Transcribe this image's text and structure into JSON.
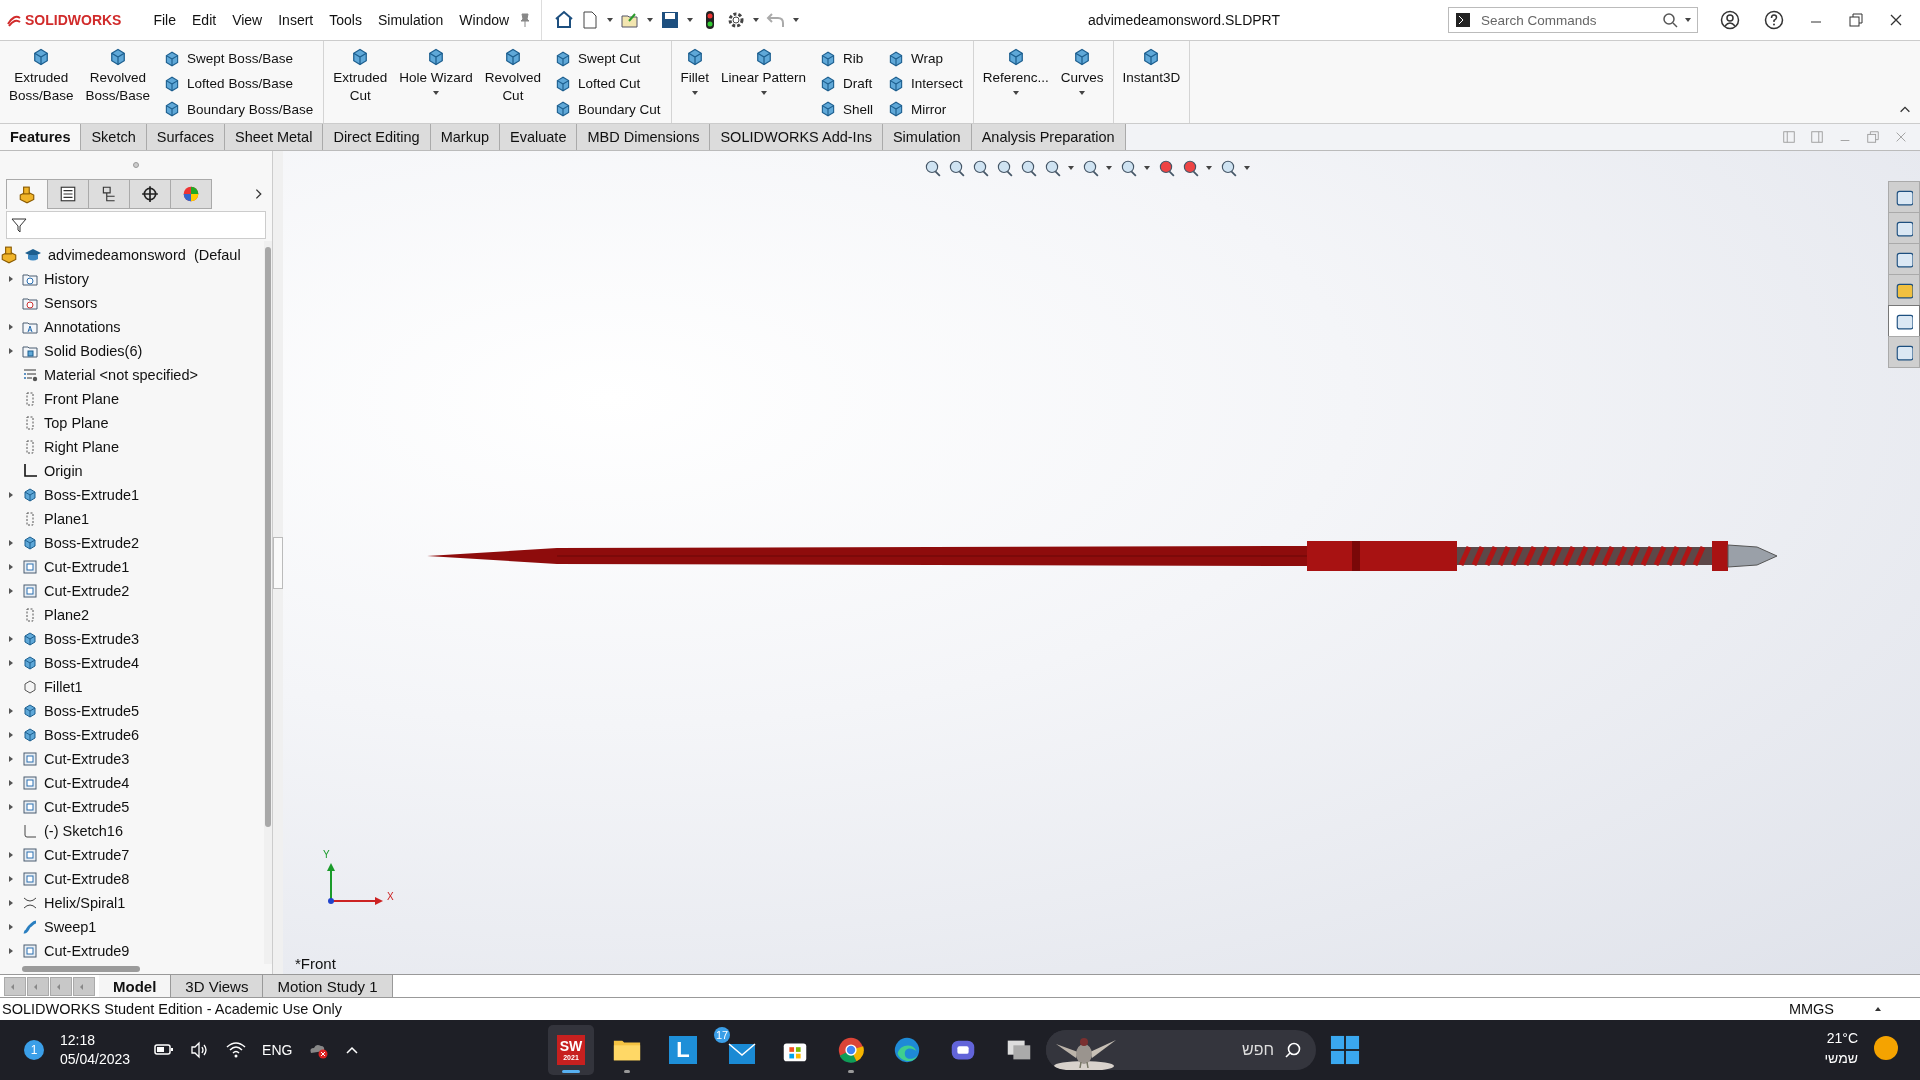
{
  "app": {
    "logo": "SOLIDWORKS"
  },
  "menu": [
    "File",
    "Edit",
    "View",
    "Insert",
    "Tools",
    "Simulation",
    "Window"
  ],
  "document_title": "advimedeamonsword.SLDPRT",
  "search": {
    "placeholder": "Search Commands"
  },
  "ribbon": {
    "groups": [
      {
        "columns": [
          {
            "kind": "large",
            "label": "Extruded\nBoss/Base",
            "dropdown": false
          },
          {
            "kind": "large",
            "label": "Revolved\nBoss/Base",
            "dropdown": false
          },
          {
            "kind": "stack",
            "items": [
              "Swept Boss/Base",
              "Lofted Boss/Base",
              "Boundary Boss/Base"
            ]
          }
        ]
      },
      {
        "columns": [
          {
            "kind": "large",
            "label": "Extruded\nCut",
            "dropdown": false
          },
          {
            "kind": "large",
            "label": "Hole Wizard",
            "dropdown": true
          },
          {
            "kind": "large",
            "label": "Revolved\nCut",
            "dropdown": false
          },
          {
            "kind": "stack",
            "items": [
              "Swept Cut",
              "Lofted Cut",
              "Boundary Cut"
            ]
          }
        ]
      },
      {
        "columns": [
          {
            "kind": "large",
            "label": "Fillet",
            "dropdown": true
          },
          {
            "kind": "large",
            "label": "Linear Pattern",
            "dropdown": true
          },
          {
            "kind": "stack",
            "items": [
              "Rib",
              "Draft",
              "Shell"
            ]
          },
          {
            "kind": "stack",
            "items": [
              "Wrap",
              "Intersect",
              "Mirror"
            ]
          }
        ]
      },
      {
        "columns": [
          {
            "kind": "large",
            "label": "Referenc...",
            "dropdown": true
          },
          {
            "kind": "large",
            "label": "Curves",
            "dropdown": true
          }
        ]
      },
      {
        "columns": [
          {
            "kind": "large",
            "label": "Instant3D",
            "dropdown": false
          }
        ]
      }
    ]
  },
  "tabs": [
    {
      "label": "Features",
      "selected": true
    },
    {
      "label": "Sketch",
      "selected": false
    },
    {
      "label": "Surfaces",
      "selected": false
    },
    {
      "label": "Sheet Metal",
      "selected": false
    },
    {
      "label": "Direct Editing",
      "selected": false
    },
    {
      "label": "Markup",
      "selected": false
    },
    {
      "label": "Evaluate",
      "selected": false
    },
    {
      "label": "MBD Dimensions",
      "selected": false
    },
    {
      "label": "SOLIDWORKS Add-Ins",
      "selected": false
    },
    {
      "label": "Simulation",
      "selected": false
    },
    {
      "label": "Analysis Preparation",
      "selected": false
    }
  ],
  "tree": {
    "root": "advimedeamonsword  (Defaul",
    "items": [
      {
        "label": "History",
        "kind": "history",
        "expandable": true
      },
      {
        "label": "Sensors",
        "kind": "sensors",
        "expandable": false
      },
      {
        "label": "Annotations",
        "kind": "annotations",
        "expandable": true
      },
      {
        "label": "Solid Bodies(6)",
        "kind": "bodies",
        "expandable": true
      },
      {
        "label": "Material <not specified>",
        "kind": "material",
        "expandable": false
      },
      {
        "label": "Front Plane",
        "kind": "plane",
        "expandable": false
      },
      {
        "label": "Top Plane",
        "kind": "plane",
        "expandable": false
      },
      {
        "label": "Right Plane",
        "kind": "plane",
        "expandable": false
      },
      {
        "label": "Origin",
        "kind": "origin",
        "expandable": false
      },
      {
        "label": "Boss-Extrude1",
        "kind": "boss",
        "expandable": true
      },
      {
        "label": "Plane1",
        "kind": "plane",
        "expandable": false
      },
      {
        "label": "Boss-Extrude2",
        "kind": "boss",
        "expandable": true
      },
      {
        "label": "Cut-Extrude1",
        "kind": "cut",
        "expandable": true
      },
      {
        "label": "Cut-Extrude2",
        "kind": "cut",
        "expandable": true
      },
      {
        "label": "Plane2",
        "kind": "plane",
        "expandable": false
      },
      {
        "label": "Boss-Extrude3",
        "kind": "boss",
        "expandable": true
      },
      {
        "label": "Boss-Extrude4",
        "kind": "boss",
        "expandable": true
      },
      {
        "label": "Fillet1",
        "kind": "fillet",
        "expandable": false
      },
      {
        "label": "Boss-Extrude5",
        "kind": "boss",
        "expandable": true
      },
      {
        "label": "Boss-Extrude6",
        "kind": "boss",
        "expandable": true
      },
      {
        "label": "Cut-Extrude3",
        "kind": "cut",
        "expandable": true
      },
      {
        "label": "Cut-Extrude4",
        "kind": "cut",
        "expandable": true
      },
      {
        "label": "Cut-Extrude5",
        "kind": "cut",
        "expandable": true
      },
      {
        "label": "(-) Sketch16",
        "kind": "sketch",
        "expandable": false
      },
      {
        "label": "Cut-Extrude7",
        "kind": "cut",
        "expandable": true
      },
      {
        "label": "Cut-Extrude8",
        "kind": "cut",
        "expandable": true
      },
      {
        "label": "Helix/Spiral1",
        "kind": "helix",
        "expandable": true
      },
      {
        "label": "Sweep1",
        "kind": "sweep",
        "expandable": true
      },
      {
        "label": "Cut-Extrude9",
        "kind": "cut",
        "expandable": true
      }
    ]
  },
  "panel_tabs": [
    {
      "selected": true
    },
    {
      "selected": false
    },
    {
      "selected": false
    },
    {
      "selected": false
    },
    {
      "selected": false
    }
  ],
  "task_pane_tabs": [
    {
      "selected": false
    },
    {
      "selected": false
    },
    {
      "selected": false
    },
    {
      "selected": false
    },
    {
      "selected": true
    },
    {
      "selected": false
    }
  ],
  "viewport": {
    "view_name": "*Front",
    "triad": {
      "y_label": "Y",
      "x_label": "X"
    }
  },
  "bottom_tabs": [
    {
      "label": "Model",
      "selected": true
    },
    {
      "label": "3D Views",
      "selected": false
    },
    {
      "label": "Motion Study 1",
      "selected": false
    }
  ],
  "status_bar": {
    "text": "SOLIDWORKS Student Edition - Academic Use Only",
    "units": "MMGS"
  },
  "taskbar": {
    "notification_count": "1",
    "time": "12:18",
    "date": "05/04/2023",
    "language": "ENG",
    "apps": [
      {
        "kind": "solidworks",
        "text": "SW",
        "subtext": "2021",
        "selected": true,
        "running": true
      },
      {
        "kind": "explorer",
        "selected": false,
        "running": true
      },
      {
        "kind": "letter",
        "text": "L",
        "selected": false,
        "running": false
      },
      {
        "kind": "mail",
        "badge": "17",
        "selected": false,
        "running": false
      },
      {
        "kind": "store",
        "selected": false,
        "running": false
      },
      {
        "kind": "chrome",
        "selected": false,
        "running": true
      },
      {
        "kind": "edge",
        "selected": false,
        "running": false
      },
      {
        "kind": "teams",
        "selected": false,
        "running": false
      },
      {
        "kind": "taskview",
        "selected": false,
        "running": false
      }
    ],
    "search_placeholder": "חפש",
    "temperature": "21°C",
    "weather": "שמשי"
  }
}
